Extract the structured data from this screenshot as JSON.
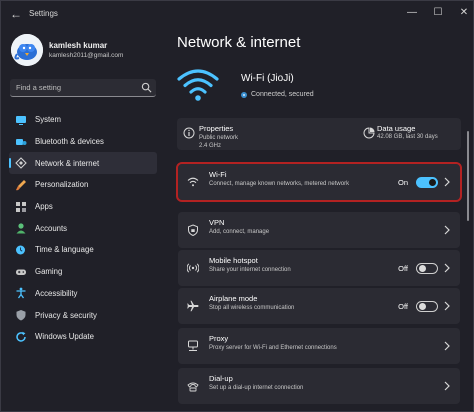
{
  "app": {
    "title": "Settings",
    "controls": [
      "—",
      "☐",
      "✕"
    ]
  },
  "user": {
    "name": "kamlesh kumar",
    "email": "kamlesh2011@gmail.com"
  },
  "search": {
    "placeholder": "Find a setting"
  },
  "nav": {
    "items": [
      {
        "label": "System",
        "icon": "monitor-icon",
        "color": "#4cc2ff",
        "active": false
      },
      {
        "label": "Bluetooth & devices",
        "icon": "bluetooth-icon",
        "color": "#4cc2ff",
        "active": false
      },
      {
        "label": "Network & internet",
        "icon": "wifi-diamond-icon",
        "color": "#c8c8c8",
        "active": true
      },
      {
        "label": "Personalization",
        "icon": "brush-icon",
        "color": "#f0a850",
        "active": false
      },
      {
        "label": "Apps",
        "icon": "apps-icon",
        "color": "#c8c8c8",
        "active": false
      },
      {
        "label": "Accounts",
        "icon": "person-icon",
        "color": "#5bc07a",
        "active": false
      },
      {
        "label": "Time & language",
        "icon": "globe-clock-icon",
        "color": "#4cc2ff",
        "active": false
      },
      {
        "label": "Gaming",
        "icon": "gamepad-icon",
        "color": "#c8c8c8",
        "active": false
      },
      {
        "label": "Accessibility",
        "icon": "accessibility-icon",
        "color": "#4cc2ff",
        "active": false
      },
      {
        "label": "Privacy & security",
        "icon": "shield-icon",
        "color": "#9aa0a8",
        "active": false
      },
      {
        "label": "Windows Update",
        "icon": "update-icon",
        "color": "#4cc2ff",
        "active": false
      }
    ]
  },
  "main": {
    "page_title": "Network & internet",
    "network": {
      "name": "Wi-Fi (JioJi)",
      "status": "Connected, secured"
    },
    "properties": {
      "title": "Properties",
      "line1": "Public network",
      "line2": "2.4 GHz"
    },
    "data_usage": {
      "title": "Data usage",
      "detail": "42.08 GB, last 30 days"
    },
    "cards": [
      {
        "title": "Wi-Fi",
        "subtitle": "Connect, manage known networks, metered network",
        "toggle_label": "On",
        "toggle_on": true,
        "icon": "wifi-icon",
        "highlight": true
      },
      {
        "title": "VPN",
        "subtitle": "Add, connect, manage",
        "icon": "vpn-shield-icon"
      },
      {
        "title": "Mobile hotspot",
        "subtitle": "Share your internet connection",
        "toggle_label": "Off",
        "toggle_on": false,
        "icon": "hotspot-icon"
      },
      {
        "title": "Airplane mode",
        "subtitle": "Stop all wireless communication",
        "toggle_label": "Off",
        "toggle_on": false,
        "icon": "airplane-icon"
      },
      {
        "title": "Proxy",
        "subtitle": "Proxy server for Wi-Fi and Ethernet connections",
        "icon": "proxy-icon"
      },
      {
        "title": "Dial-up",
        "subtitle": "Set up a dial-up internet connection",
        "icon": "dialup-icon"
      }
    ]
  },
  "colors": {
    "accent": "#4cc2ff",
    "highlight_border": "#b32222"
  }
}
